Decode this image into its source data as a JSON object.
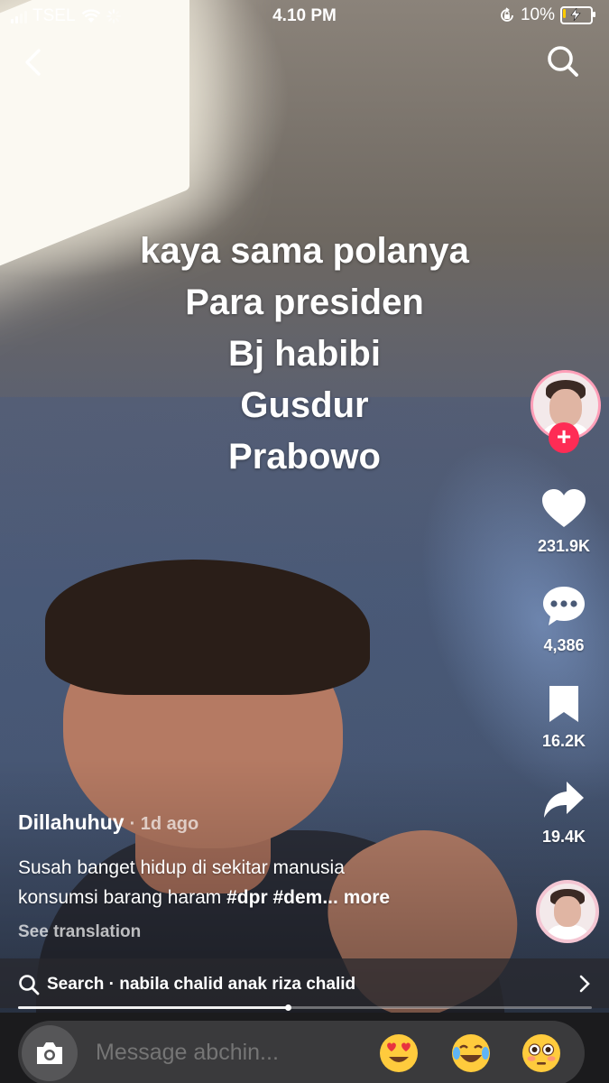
{
  "status_bar": {
    "carrier": "TSEL",
    "time": "4.10 PM",
    "battery_percent": "10%",
    "battery_level": 0.1,
    "battery_color": "#ffcc00"
  },
  "overlay_caption": {
    "lines": [
      "kaya sama polanya",
      "Para presiden",
      "Bj habibi",
      "Gusdur",
      "Prabowo"
    ]
  },
  "actions": {
    "likes": "231.9K",
    "comments": "4,386",
    "saves": "16.2K",
    "shares": "19.4K"
  },
  "post": {
    "author": "Dillahuhuy",
    "posted": "· 1d ago",
    "description_line1": "Susah banget hidup di sekitar manusia",
    "description_line2": "konsumsi barang haram ",
    "tag1": "#dpr",
    "tag2": "#dem...",
    "more": "more",
    "see_translation": "See translation"
  },
  "search_suggestion": {
    "label": "Search · nabila chalid anak riza chalid"
  },
  "playback": {
    "progress_fraction": 0.47
  },
  "message_bar": {
    "placeholder": "Message abchin..."
  },
  "colors": {
    "follow_accent": "#fe2c55",
    "avatar_ring": "#ff9fb8"
  }
}
